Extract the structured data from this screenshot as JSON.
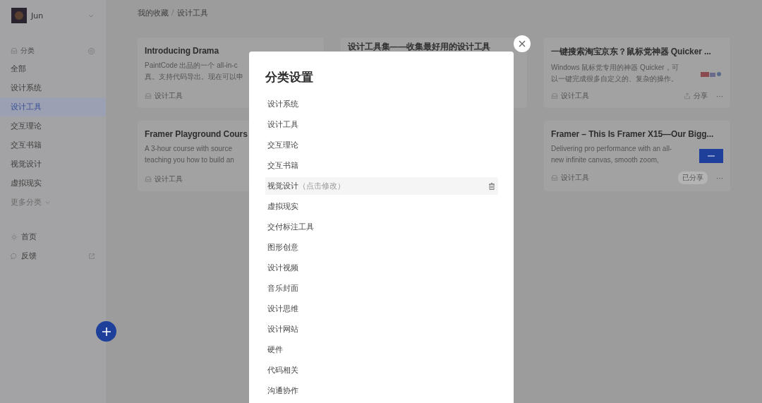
{
  "sidebar": {
    "user": {
      "name": "Jun"
    },
    "section": {
      "label": "分类"
    },
    "items": [
      {
        "label": "全部",
        "selected": false
      },
      {
        "label": "设计系统",
        "selected": false
      },
      {
        "label": "设计工具",
        "selected": true
      },
      {
        "label": "交互理论",
        "selected": false
      },
      {
        "label": "交互书籍",
        "selected": false
      },
      {
        "label": "视觉设计",
        "selected": false
      },
      {
        "label": "虚拟现实",
        "selected": false
      }
    ],
    "more": "更多分类",
    "links": [
      {
        "label": "首页",
        "kind": "home"
      },
      {
        "label": "反馈",
        "kind": "feedback"
      }
    ]
  },
  "breadcrumb": {
    "items": [
      "我的收藏",
      "设计工具"
    ],
    "separator": "/"
  },
  "columns": [
    [
      {
        "title": "Introducing Drama",
        "lines": [
          "PaintCode 出品的一个 all-in-c",
          "真。支持代码导出。现在可以申"
        ],
        "tag": "设计工具"
      },
      {
        "title": "Framer Playground Cours",
        "lines": [
          "A 3-hour course with source",
          "teaching you how to build an"
        ],
        "tag": "设计工具"
      }
    ],
    [
      {
        "title": "设计工具集——收集最好用的设计工具"
      }
    ],
    [
      {
        "title": "一键搜索淘宝京东？鼠标党神器 Quicker ...",
        "lines": [
          "Windows 鼠标党专用的神器 Quicker，可",
          "以一键完成很多自定义的、复杂的操作。"
        ],
        "tag": "设计工具",
        "thumbnail": {
          "kind": "picture"
        },
        "share": {
          "label": "分享",
          "shared": false
        },
        "more": "···"
      },
      {
        "title": "Framer – This Is Framer X15—Our Bigg...",
        "lines": [
          "Delivering pro performance with an all-",
          "new infinite canvas, smooth zoom,"
        ],
        "tag": "设计工具",
        "thumbnail": {
          "kind": "picture"
        },
        "share": {
          "label": "已分享",
          "shared": true
        },
        "more": "···"
      }
    ]
  ],
  "modal": {
    "title": "分类设置",
    "items": [
      {
        "label": "设计系统",
        "hovered": false
      },
      {
        "label": "设计工具",
        "hovered": false
      },
      {
        "label": "交互理论",
        "hovered": false
      },
      {
        "label": "交互书籍",
        "hovered": false
      },
      {
        "label": "视觉设计",
        "hovered": true,
        "hint": "（点击修改）"
      },
      {
        "label": "虚拟现实",
        "hovered": false
      },
      {
        "label": "交付标注工具",
        "hovered": false
      },
      {
        "label": "图形创意",
        "hovered": false
      },
      {
        "label": "设计视频",
        "hovered": false
      },
      {
        "label": "音乐封面",
        "hovered": false
      },
      {
        "label": "设计思维",
        "hovered": false
      },
      {
        "label": "设计网站",
        "hovered": false
      },
      {
        "label": "硬件",
        "hovered": false
      },
      {
        "label": "代码相关",
        "hovered": false
      },
      {
        "label": "沟通协作",
        "hovered": false
      }
    ]
  }
}
